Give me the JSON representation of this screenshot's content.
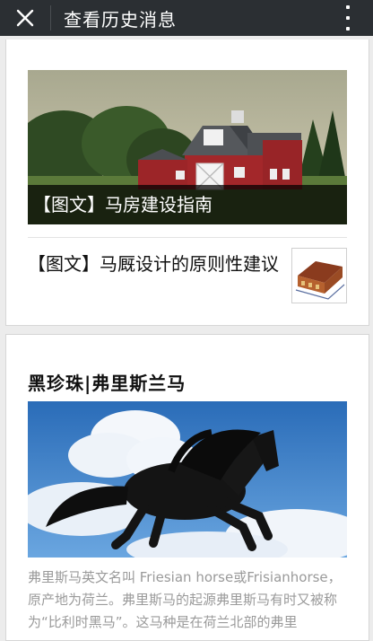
{
  "header": {
    "title": "查看历史消息",
    "close_icon": "close-icon",
    "more_icon": "more-vertical-icon"
  },
  "card1": {
    "cover_caption": "【图文】马房建设指南",
    "item_title": "【图文】马厩设计的原则性建议"
  },
  "card2": {
    "heading": "黑珍珠|弗里斯兰马",
    "description": "弗里斯马英文名叫 Friesian horse或Frisianhorse，原产地为荷兰。弗里斯马的起源弗里斯马有时又被称为“比利时黑马”。这马种是在荷兰北部的弗里"
  },
  "colors": {
    "topbar": "#2b2f33",
    "card": "#ffffff",
    "background": "#ececec",
    "caption_overlay": "#000000",
    "description_text": "#9a9a9a"
  }
}
